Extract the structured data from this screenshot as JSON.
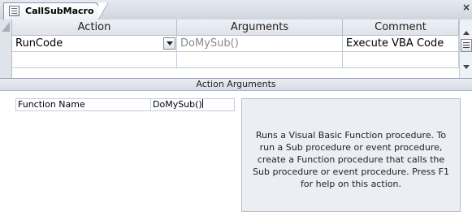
{
  "tab": {
    "title": "CallSubMacro",
    "close": "×"
  },
  "columns": {
    "action": "Action",
    "arguments": "Arguments",
    "comment": "Comment"
  },
  "rows": [
    {
      "action": "RunCode",
      "arguments": "DoMySub()",
      "comment": "Execute VBA Code"
    }
  ],
  "action_arguments": {
    "header": "Action Arguments",
    "field_label": "Function Name",
    "field_value": "DoMySub()",
    "help": "Runs a Visual Basic Function procedure. To run a Sub procedure or event procedure, create a Function procedure that calls the Sub procedure or event procedure. Press F1 for help on this action."
  }
}
